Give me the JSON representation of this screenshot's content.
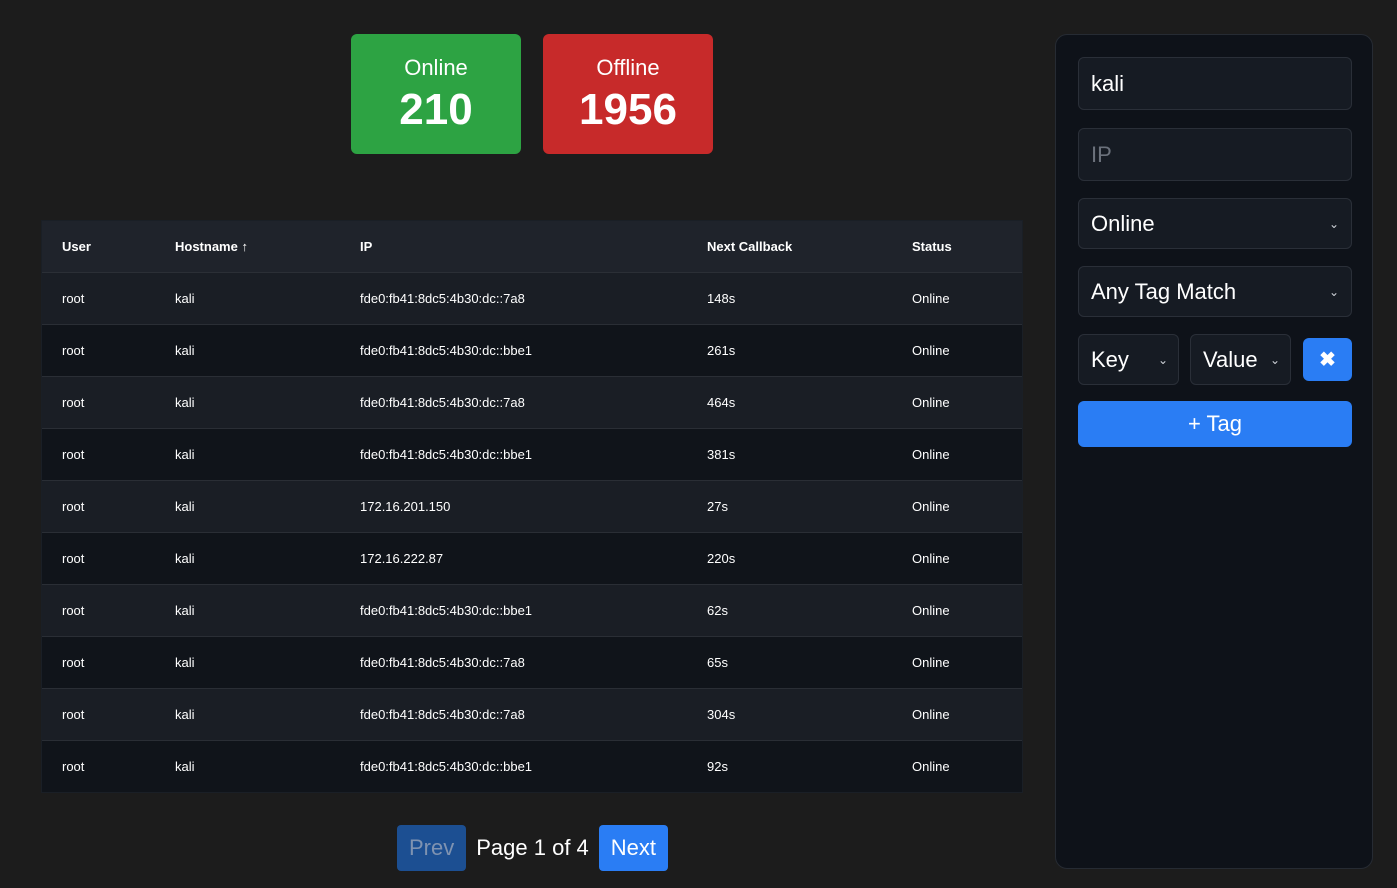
{
  "stats": {
    "online_label": "Online",
    "online_count": "210",
    "offline_label": "Offline",
    "offline_count": "1956"
  },
  "table": {
    "headers": {
      "user": "User",
      "hostname": "Hostname ↑",
      "ip": "IP",
      "next_callback": "Next Callback",
      "status": "Status"
    },
    "rows": [
      {
        "user": "root",
        "hostname": "kali",
        "ip": "fde0:fb41:8dc5:4b30:dc::7a8",
        "next_callback": "148s",
        "status": "Online"
      },
      {
        "user": "root",
        "hostname": "kali",
        "ip": "fde0:fb41:8dc5:4b30:dc::bbe1",
        "next_callback": "261s",
        "status": "Online"
      },
      {
        "user": "root",
        "hostname": "kali",
        "ip": "fde0:fb41:8dc5:4b30:dc::7a8",
        "next_callback": "464s",
        "status": "Online"
      },
      {
        "user": "root",
        "hostname": "kali",
        "ip": "fde0:fb41:8dc5:4b30:dc::bbe1",
        "next_callback": "381s",
        "status": "Online"
      },
      {
        "user": "root",
        "hostname": "kali",
        "ip": "172.16.201.150",
        "next_callback": "27s",
        "status": "Online"
      },
      {
        "user": "root",
        "hostname": "kali",
        "ip": "172.16.222.87",
        "next_callback": "220s",
        "status": "Online"
      },
      {
        "user": "root",
        "hostname": "kali",
        "ip": "fde0:fb41:8dc5:4b30:dc::bbe1",
        "next_callback": "62s",
        "status": "Online"
      },
      {
        "user": "root",
        "hostname": "kali",
        "ip": "fde0:fb41:8dc5:4b30:dc::7a8",
        "next_callback": "65s",
        "status": "Online"
      },
      {
        "user": "root",
        "hostname": "kali",
        "ip": "fde0:fb41:8dc5:4b30:dc::7a8",
        "next_callback": "304s",
        "status": "Online"
      },
      {
        "user": "root",
        "hostname": "kali",
        "ip": "fde0:fb41:8dc5:4b30:dc::bbe1",
        "next_callback": "92s",
        "status": "Online"
      }
    ]
  },
  "pager": {
    "prev_label": "Prev",
    "page_text": "Page 1 of 4",
    "next_label": "Next"
  },
  "filters": {
    "hostname_value": "kali",
    "ip_placeholder": "IP",
    "status_selected": "Online",
    "tag_match_selected": "Any Tag Match",
    "key_selected": "Key",
    "value_selected": "Value",
    "remove_icon": "close-icon",
    "add_tag_label": "+ Tag"
  },
  "colors": {
    "online": "#2da343",
    "offline": "#c72a2a",
    "accent": "#2a7df4"
  }
}
